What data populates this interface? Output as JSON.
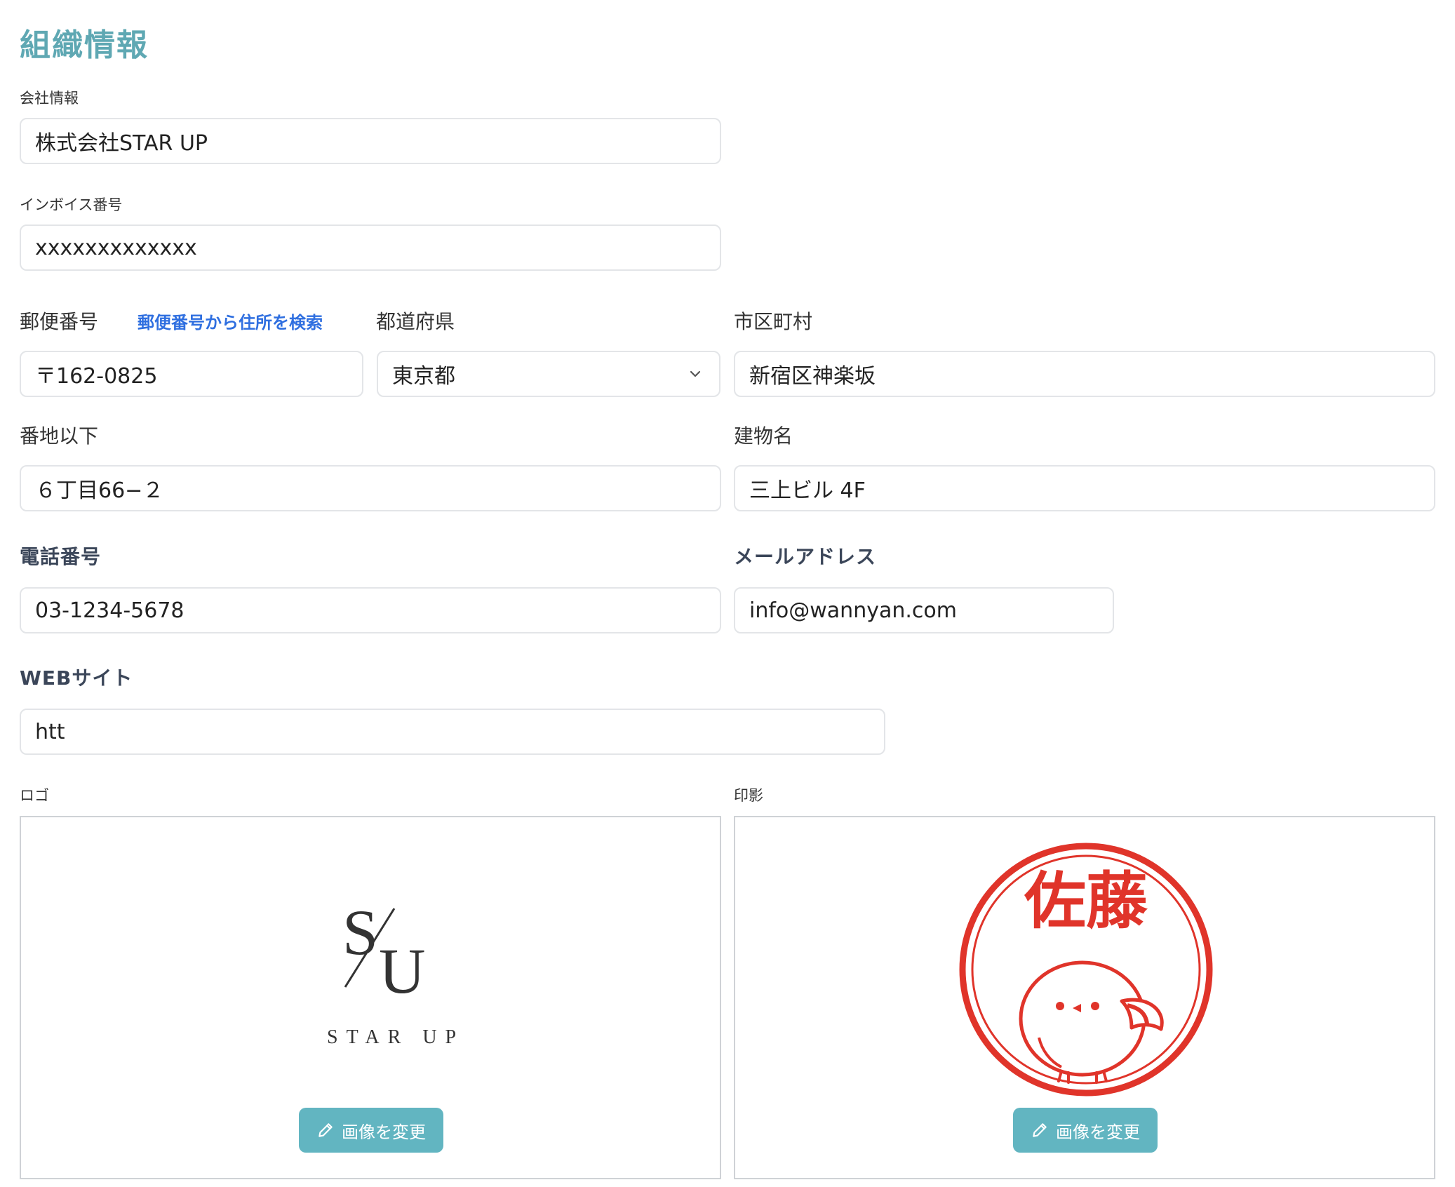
{
  "page": {
    "title": "組織情報"
  },
  "company": {
    "label": "会社情報",
    "value": "株式会社STAR UP"
  },
  "invoice": {
    "label": "インボイス番号",
    "value": "xxxxxxxxxxxxx"
  },
  "postal": {
    "label": "郵便番号",
    "lookup_link": "郵便番号から住所を検索",
    "value": "〒162-0825"
  },
  "prefecture": {
    "label": "都道府県",
    "value": "東京都"
  },
  "city": {
    "label": "市区町村",
    "value": "新宿区神楽坂"
  },
  "street": {
    "label": "番地以下",
    "value": "６丁目66−２"
  },
  "building": {
    "label": "建物名",
    "value": "三上ビル 4F"
  },
  "phone": {
    "label": "電話番号",
    "value": "03-1234-5678"
  },
  "email": {
    "label": "メールアドレス",
    "value": "info@wannyan.com"
  },
  "website": {
    "label": "WEBサイト",
    "value": "htt"
  },
  "logo": {
    "label": "ロゴ",
    "text_monogram_s": "S",
    "text_monogram_u": "U",
    "text_name": "STAR UP",
    "button_label": "画像を変更"
  },
  "seal": {
    "label": "印影",
    "text": "佐藤",
    "color": "#e0342a",
    "button_label": "画像を変更"
  },
  "colors": {
    "accent": "#62b5c1",
    "title": "#5fa8b3",
    "link": "#2f6fe0"
  }
}
